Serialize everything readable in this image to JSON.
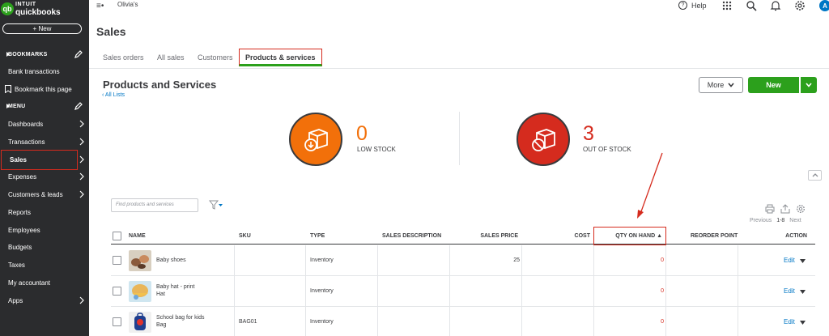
{
  "logo": {
    "badge": "qb",
    "line1": "INTUIT",
    "line2": "quickbooks"
  },
  "sidebar": {
    "new_label": "+ New",
    "bookmarks_header": "BOOKMARKS",
    "bookmark_items": [
      {
        "label": "Bank transactions"
      },
      {
        "label": "Bookmark this page"
      }
    ],
    "menu_header": "MENU",
    "menu_items": [
      {
        "label": "Dashboards"
      },
      {
        "label": "Transactions"
      },
      {
        "label": "Sales"
      },
      {
        "label": "Expenses"
      },
      {
        "label": "Customers & leads"
      },
      {
        "label": "Reports"
      },
      {
        "label": "Employees"
      },
      {
        "label": "Budgets"
      },
      {
        "label": "Taxes"
      },
      {
        "label": "My accountant"
      },
      {
        "label": "Apps"
      }
    ]
  },
  "topbar": {
    "company": "Olivia's",
    "help_label": "Help",
    "avatar_letter": "A"
  },
  "page": {
    "title": "Sales",
    "tabs": [
      {
        "label": "Sales orders"
      },
      {
        "label": "All sales"
      },
      {
        "label": "Customers"
      },
      {
        "label": "Products & services"
      }
    ],
    "section_title": "Products and Services",
    "all_lists": "All Lists",
    "more_label": "More",
    "new_label": "New"
  },
  "stock": {
    "low": {
      "count": "0",
      "label": "LOW STOCK",
      "color": "#f2700a"
    },
    "out": {
      "count": "3",
      "label": "OUT OF STOCK",
      "color": "#d52b1e"
    }
  },
  "filter": {
    "search_placeholder": "Find products and services"
  },
  "pager": {
    "prev": "Previous",
    "range": "1-8",
    "next": "Next"
  },
  "table": {
    "headers": {
      "name": "NAME",
      "sku": "SKU",
      "type": "TYPE",
      "sales_description": "SALES DESCRIPTION",
      "sales_price": "SALES PRICE",
      "cost": "COST",
      "qty_on_hand": "QTY ON HAND ▲",
      "reorder_point": "REORDER POINT",
      "action": "ACTION"
    },
    "rows": [
      {
        "name1": "Baby shoes",
        "name2": "",
        "sku": "",
        "type": "Inventory",
        "sales_description": "",
        "sales_price": "25",
        "cost": "",
        "qty": "0",
        "reorder": "",
        "action": "Edit"
      },
      {
        "name1": "Baby hat - print",
        "name2": "Hat",
        "sku": "",
        "type": "Inventory",
        "sales_description": "",
        "sales_price": "",
        "cost": "",
        "qty": "0",
        "reorder": "",
        "action": "Edit"
      },
      {
        "name1": "School bag for kids",
        "name2": "Bag",
        "sku": "BAG01",
        "type": "Inventory",
        "sales_description": "",
        "sales_price": "",
        "cost": "",
        "qty": "0",
        "reorder": "",
        "action": "Edit"
      }
    ]
  },
  "colors": {
    "brand_green": "#2ca01c",
    "link_blue": "#0077c5",
    "highlight_red": "#d52b1e",
    "sidebar_bg": "#2b2c2e"
  }
}
